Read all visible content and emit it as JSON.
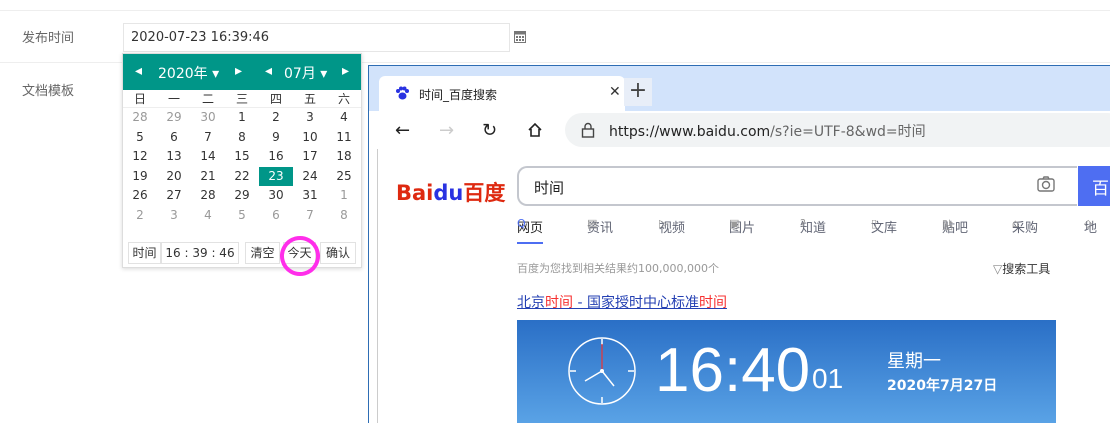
{
  "form": {
    "publish_label": "发布时间",
    "publish_value": "2020-07-23 16:39:46",
    "template_label": "文档模板"
  },
  "datepicker": {
    "year": "2020年",
    "month": "07月",
    "weekdays": [
      "日",
      "一",
      "二",
      "三",
      "四",
      "五",
      "六"
    ],
    "rows": [
      [
        "28",
        "29",
        "30",
        "1",
        "2",
        "3",
        "4"
      ],
      [
        "5",
        "6",
        "7",
        "8",
        "9",
        "10",
        "11"
      ],
      [
        "12",
        "13",
        "14",
        "15",
        "16",
        "17",
        "18"
      ],
      [
        "19",
        "20",
        "21",
        "22",
        "23",
        "24",
        "25"
      ],
      [
        "26",
        "27",
        "28",
        "29",
        "30",
        "31",
        "1"
      ],
      [
        "2",
        "3",
        "4",
        "5",
        "6",
        "7",
        "8"
      ]
    ],
    "selected_day": "23",
    "time_label": "时间",
    "time_value": "16 : 39 : 46",
    "clear": "清空",
    "today": "今天",
    "confirm": "确认"
  },
  "browser": {
    "tab_title": "时间_百度搜索",
    "url_main": "https://www.baidu.com",
    "url_rest": "/s?ie=UTF-8&wd=时间",
    "logo_bai": "Bai",
    "logo_du": "du",
    "logo_cn": "百度",
    "query": "时间",
    "search_btn": "百",
    "tabs": [
      "网页",
      "资讯",
      "视频",
      "图片",
      "知道",
      "文库",
      "贴吧",
      "采购",
      "地"
    ],
    "result_count": "百度为您找到相关结果约100,000,000个",
    "search_tools": "搜索工具",
    "result_title_pre": "北京",
    "result_title_em": "时间",
    "result_title_mid": " - 国家授时中心标准",
    "result_title_em2": "时间",
    "clock_time": "16:40",
    "clock_secs": "01",
    "weekday": "星期一",
    "date": "2020年7月27日"
  },
  "colors": {
    "accent": "#009688",
    "highlight_circle": "#ff2eea",
    "baidu_blue": "#4e6ef2"
  }
}
